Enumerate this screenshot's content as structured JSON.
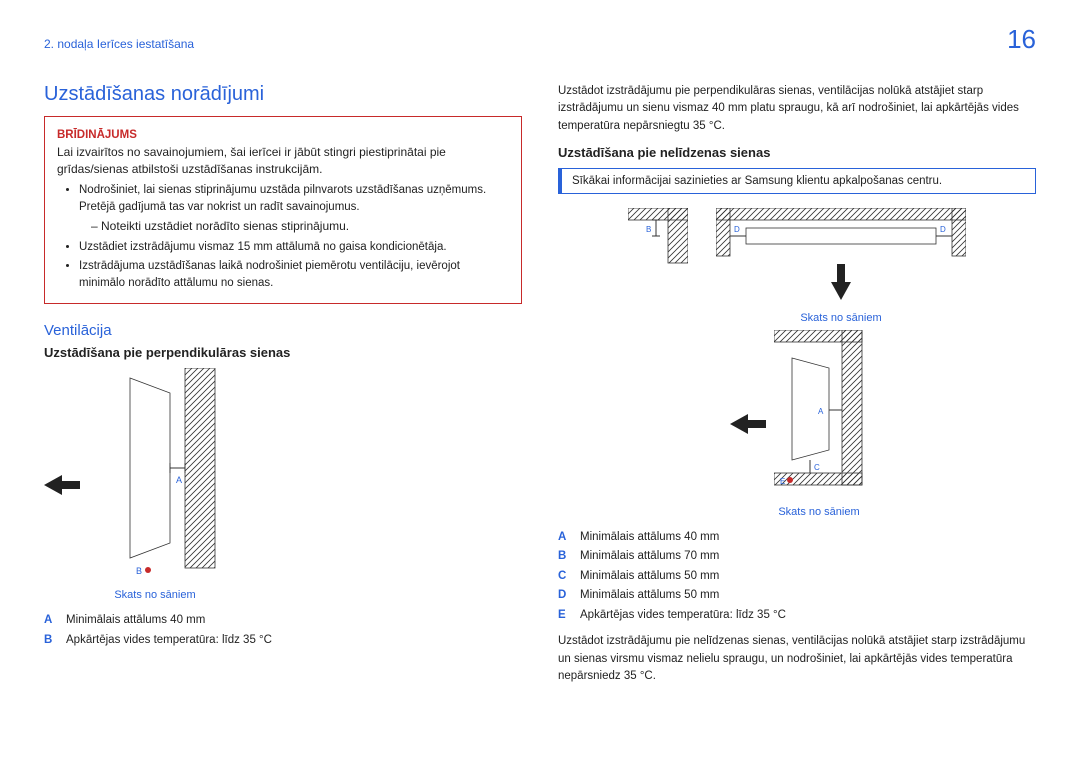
{
  "header": {
    "chapter": "2. nodaļa Ierīces iestatīšana",
    "page": "16"
  },
  "left": {
    "title": "Uzstādīšanas norādījumi",
    "warning": {
      "label": "BRĪDINĀJUMS",
      "intro": "Lai izvairītos no savainojumiem, šai ierīcei ir jābūt stingri piestiprinātai pie grīdas/sienas atbilstoši uzstādīšanas instrukcijām.",
      "b1": "Nodrošiniet, lai sienas stiprinājumu uzstāda pilnvarots uzstādīšanas uzņēmums. Pretējā gadījumā tas var nokrist un radīt savainojumus.",
      "sub": "Noteikti uzstādiet norādīto sienas stiprinājumu.",
      "b2": "Uzstādiet izstrādājumu vismaz 15 mm attālumā no gaisa kondicionētāja.",
      "b3": "Izstrādājuma uzstādīšanas laikā nodrošiniet piemērotu ventilāciju, ievērojot minimālo norādīto attālumu no sienas."
    },
    "vent_title": "Ventilācija",
    "perp_title": "Uzstādīšana pie perpendikulāras sienas",
    "fig1": {
      "labelA": "A",
      "labelB": "B",
      "caption": "Skats no sāniem"
    },
    "legend1": {
      "A": {
        "key": "A",
        "text": "Minimālais attālums 40 mm"
      },
      "B": {
        "key": "B",
        "text": "Apkārtējas vides temperatūra: līdz 35 °C"
      }
    }
  },
  "right": {
    "intro": "Uzstādot izstrādājumu pie perpendikulāras sienas, ventilācijas nolūkā atstājiet starp izstrādājumu un sienu vismaz 40 mm platu spraugu, kā arī nodrošiniet, lai apkārtējās vides temperatūra nepārsniegtu 35 °C.",
    "indent_title": "Uzstādīšana pie nelīdzenas sienas",
    "info": "Sīkākai informācijai sazinieties ar Samsung klientu apkalpošanas centru.",
    "fig2": {
      "labelA": "A",
      "labelB": "B",
      "labelC": "C",
      "labelD1": "D",
      "labelD2": "D",
      "labelE": "E",
      "caption_side": "Skats no sāniem",
      "caption_top": "Skats no sāniem"
    },
    "legend2": {
      "A": {
        "key": "A",
        "text": "Minimālais attālums 40 mm"
      },
      "B": {
        "key": "B",
        "text": "Minimālais attālums 70 mm"
      },
      "C": {
        "key": "C",
        "text": "Minimālais attālums 50 mm"
      },
      "D": {
        "key": "D",
        "text": "Minimālais attālums 50 mm"
      },
      "E": {
        "key": "E",
        "text": "Apkārtējas vides temperatūra: līdz 35 °C"
      }
    },
    "outro": "Uzstādot izstrādājumu pie nelīdzenas sienas, ventilācijas nolūkā atstājiet starp izstrādājumu un sienas virsmu vismaz nelielu spraugu, un nodrošiniet, lai apkārtējās vides temperatūra nepārsniedz 35 °C."
  }
}
